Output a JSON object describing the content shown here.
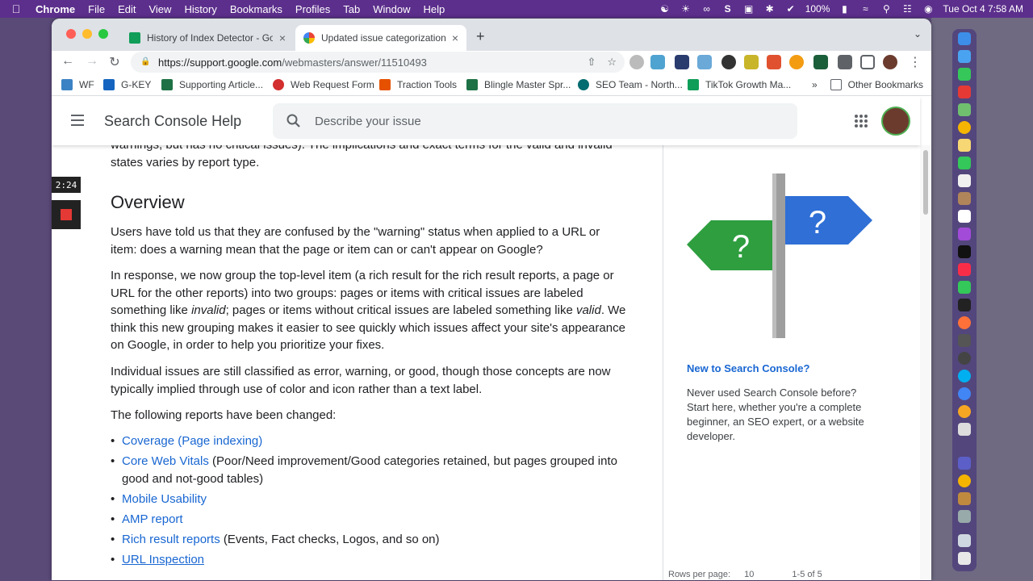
{
  "menubar": {
    "app": "Chrome",
    "items": [
      "File",
      "Edit",
      "View",
      "History",
      "Bookmarks",
      "Profiles",
      "Tab",
      "Window",
      "Help"
    ],
    "battery": "100%",
    "clock": "Tue Oct 4  7:58 AM"
  },
  "tabs": [
    {
      "title": "History of Index Detector - Go",
      "close": "×"
    },
    {
      "title": "Updated issue categorization i",
      "close": "×"
    }
  ],
  "newtab": "+",
  "toolbar": {
    "url_host": "https://support.google.com",
    "url_path": "/webmasters/answer/11510493"
  },
  "bookmarks": [
    {
      "label": "WF"
    },
    {
      "label": "G-KEY"
    },
    {
      "label": "Supporting Article..."
    },
    {
      "label": "Web Request Form"
    },
    {
      "label": "Traction Tools"
    },
    {
      "label": "Blingle Master Spr..."
    },
    {
      "label": "SEO Team - North..."
    },
    {
      "label": "TikTok Growth Ma..."
    }
  ],
  "bookmarks_more": "»",
  "bookmarks_other": "Other Bookmarks",
  "appbar": {
    "title": "Search Console Help",
    "search_placeholder": "Describe your issue"
  },
  "article": {
    "intro_tail_1": "warnings, but has no critical issues). The implications and exact terms for the valid and invalid",
    "intro_tail_2": "states varies by report type.",
    "heading": "Overview",
    "p1": "Users have told us that they are confused by the \"warning\" status when applied to a URL or item: does a warning mean that the page or item can or can't appear on Google?",
    "p2_a": "In response, we now group the top-level item (a rich result for the rich result reports, a page or URL for the other reports) into two groups: pages or items with critical issues are labeled something like ",
    "p2_invalid": "invalid",
    "p2_b": "; pages or items without critical issues are labeled something like ",
    "p2_valid": "valid",
    "p2_c": ". We think this new grouping makes it easier to see quickly which issues affect your site's appearance on Google, in order to help you prioritize your fixes.",
    "p3": "Individual issues are still classified as error, warning, or good, though those concepts are now typically implied through use of color and icon rather than a text label.",
    "p4": "The following reports have been changed:",
    "list": [
      {
        "link": "Coverage (Page indexing)",
        "rest": ""
      },
      {
        "link": "Core Web Vitals",
        "rest": " (Poor/Need improvement/Good categories retained, but pages grouped into good and not-good tables)"
      },
      {
        "link": "Mobile Usability",
        "rest": ""
      },
      {
        "link": "AMP report",
        "rest": ""
      },
      {
        "link": "Rich result reports",
        "rest": " (Events, Fact checks, Logos, and so on)"
      },
      {
        "link": "URL Inspection",
        "rest": ""
      }
    ]
  },
  "sidebar": {
    "signpost_mark": "?",
    "title": "New to Search Console?",
    "text": "Never used Search Console before? Start here, whether you're a complete beginner, an SEO expert, or a website developer."
  },
  "recorder": {
    "timer": "2:24"
  },
  "behind_window": {
    "rows_per_page_label": "Rows per page:",
    "rows_per_page_value": "10",
    "range": "1-5 of 5"
  }
}
